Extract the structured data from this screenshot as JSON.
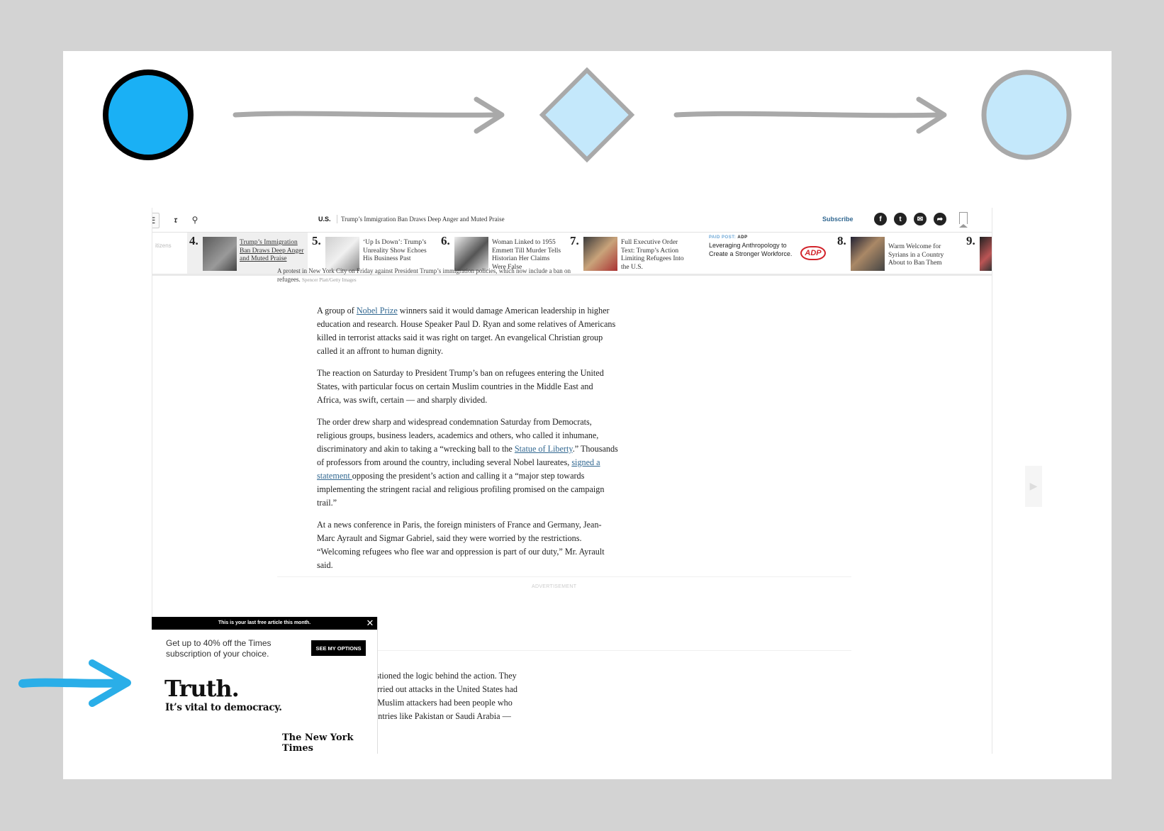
{
  "topbar": {
    "section": "U.S.",
    "headline": "Trump’s Immigration Ban Draws Deep Anger and Muted Praise",
    "subscribe": "Subscribe",
    "share_icons": [
      "facebook-icon",
      "twitter-icon",
      "email-icon",
      "share-icon"
    ]
  },
  "ribbon": {
    "fade_text": "itizens",
    "items": [
      {
        "num": "4.",
        "text": "Trump’s Immigration Ban Draws Deep Anger and Muted Praise"
      },
      {
        "num": "5.",
        "text": "‘Up Is Down’: Trump’s Unreality Show Echoes His Business Past"
      },
      {
        "num": "6.",
        "text": "Woman Linked to 1955 Emmett Till Murder Tells Historian Her Claims Were False"
      },
      {
        "num": "7.",
        "text": "Full Executive Order Text: Trump’s Action Limiting Refugees Into the U.S."
      },
      {
        "num": "8.",
        "text": "Warm Welcome for Syrians in a Country About to Ban Them"
      },
      {
        "num": "9.",
        "text": ""
      }
    ],
    "paid_tag": "PAID POST:",
    "paid_brand": "ADP",
    "paid_text": "Leveraging Anthropology to Create a Stronger Workforce.",
    "adp_logo": "ADP"
  },
  "caption": {
    "text": "A protest in New York City on Friday against President Trump’s immigration policies, which now include a ban on refugees.",
    "credit": "Spencer Platt/Getty Images"
  },
  "article": {
    "p1_a": "A group of ",
    "p1_link": "Nobel Prize",
    "p1_b": " winners said it would damage American leadership in higher education and research. House Speaker Paul D. Ryan and some relatives of Americans killed in terrorist attacks said it was right on target. An evangelical Christian group called it an affront to human dignity.",
    "p2": "The reaction on Saturday to President Trump’s ban on refugees entering the United States, with particular focus on certain Muslim countries in the Middle East and Africa, was swift, certain — and sharply divided.",
    "p3_a": "The order drew sharp and widespread condemnation Saturday from Democrats, religious groups, business leaders, academics and others, who called it inhumane, discriminatory and akin to taking a “wrecking ball to the ",
    "p3_link1": "Statue of Liberty",
    "p3_b": ".” Thousands of professors from around the country, including several Nobel laureates, ",
    "p3_link2": "signed a statement ",
    "p3_c": "opposing the president’s action and calling it a “major step towards implementing the stringent racial and religious profiling promised on the campaign trail.”",
    "p4": "At a news conference in Paris, the foreign ministers of France and Germany, Jean-Marc Ayrault and Sigmar Gabriel, said they were worried by the restrictions. “Welcoming refugees who flee war and oppression is part of our duty,” Mr. Ayrault said.",
    "ad_label": "ADVERTISEMENT",
    "cut_lines": [
      "olicy experts questioned the logic behind the action. They",
      "orists who had carried out attacks in the United States had",
      "efugees, and that Muslim attackers had been people who",
      "or came from countries like Pakistan or Saudi Arabia —"
    ]
  },
  "popup": {
    "bar": "This is your last free article this month.",
    "offer": "Get up to 40% off the Times subscription of your choice.",
    "button": "SEE MY OPTIONS",
    "truth": "Truth.",
    "tagline": "It’s vital to democracy.",
    "logo": "The New York Times"
  },
  "colors": {
    "start_event": "#1ab0f5",
    "pale_blue": "#c4e8fb",
    "gray": "#a9a9a9",
    "link": "#326891",
    "annotation_arrow": "#2aaee8"
  }
}
